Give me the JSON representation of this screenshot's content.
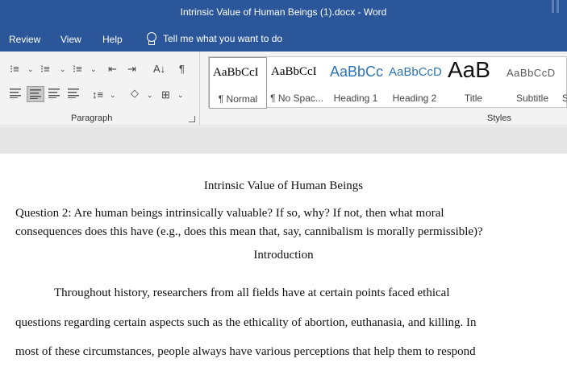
{
  "window": {
    "title": "Intrinsic Value of Human Beings (1).docx  -  Word"
  },
  "menu": {
    "items": [
      "Review",
      "View",
      "Help"
    ],
    "tell_me": "Tell me what you want to do"
  },
  "ribbon": {
    "paragraph_label": "Paragraph",
    "styles_label": "Styles",
    "styles": [
      {
        "preview": "AaBbCcI",
        "name": "¶ Normal"
      },
      {
        "preview": "AaBbCcI",
        "name": "¶ No Spac..."
      },
      {
        "preview": "AaBbCc",
        "name": "Heading 1"
      },
      {
        "preview": "AaBbCcD",
        "name": "Heading 2"
      },
      {
        "preview": "AaB",
        "name": "Title"
      },
      {
        "preview": "AaBbCcD",
        "name": "Subtitle"
      },
      {
        "preview": "",
        "name": "S"
      }
    ]
  },
  "document": {
    "title": "Intrinsic Value of Human Beings",
    "question_line1": "Question 2: Are human beings intrinsically valuable? If so, why? If not, then what moral",
    "question_line2": "consequences does this have (e.g., does this mean that, say, cannibalism is morally permissible)?",
    "heading": "Introduction",
    "body_line1": "Throughout history, researchers from all fields have at certain points faced ethical",
    "body_line2": "questions regarding certain aspects such as the ethicality of abortion, euthanasia, and killing. In",
    "body_line3": "most of these circumstances, people always have various perceptions that help them to respond"
  },
  "colors": {
    "accent": "#2b579a",
    "heading_blue": "#2e74b5"
  }
}
